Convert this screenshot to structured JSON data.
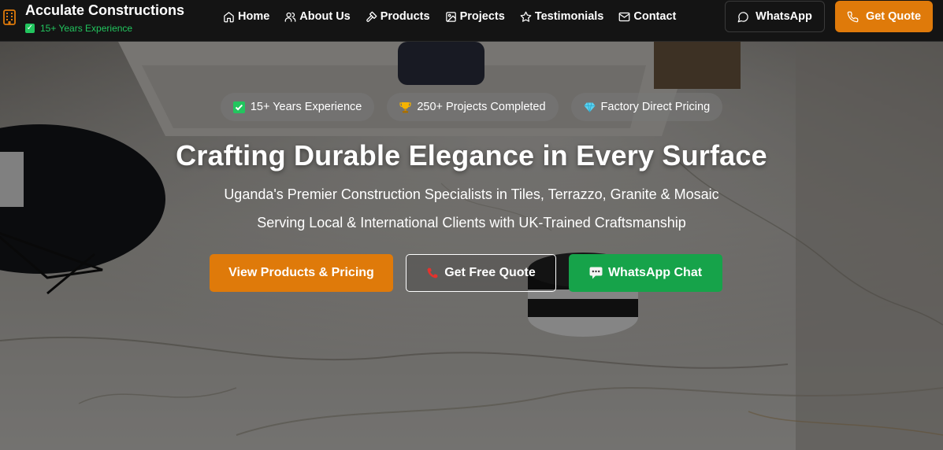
{
  "brand": {
    "name": "Acculate Constructions",
    "tagline": "15+ Years Experience"
  },
  "nav": {
    "items": [
      {
        "label": "Home",
        "icon": "home-icon"
      },
      {
        "label": "About Us",
        "icon": "users-icon"
      },
      {
        "label": "Products",
        "icon": "hammer-icon"
      },
      {
        "label": "Projects",
        "icon": "image-icon"
      },
      {
        "label": "Testimonials",
        "icon": "star-icon"
      },
      {
        "label": "Contact",
        "icon": "mail-icon"
      }
    ],
    "whatsapp_label": "WhatsApp",
    "quote_label": "Get Quote"
  },
  "hero": {
    "badges": [
      {
        "label": "15+ Years Experience",
        "icon": "check-icon"
      },
      {
        "label": "250+ Projects Completed",
        "icon": "trophy-icon"
      },
      {
        "label": "Factory Direct Pricing",
        "icon": "diamond-icon"
      }
    ],
    "title": "Crafting Durable Elegance in Every Surface",
    "subtitle_1": "Uganda's Premier Construction Specialists in Tiles, Terrazzo, Granite & Mosaic",
    "subtitle_2": "Serving Local & International Clients with UK-Trained Craftsmanship",
    "cta": {
      "products_label": "View Products & Pricing",
      "quote_label": "Get Free Quote",
      "whatsapp_label": "WhatsApp Chat"
    }
  },
  "colors": {
    "accent": "#df7a0a",
    "whatsapp_green": "#16a34a",
    "tag_green": "#22c55e",
    "header_bg": "#141414"
  }
}
